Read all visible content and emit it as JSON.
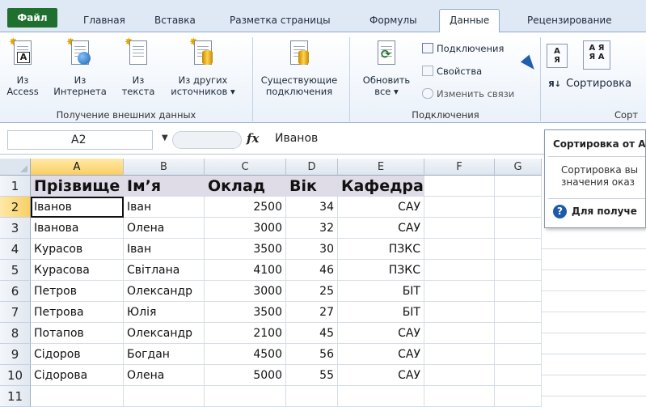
{
  "tabs": [
    "Файл",
    "Главная",
    "Вставка",
    "Разметка страницы",
    "Формулы",
    "Данные",
    "Рецензирование"
  ],
  "active_tab": "Данные",
  "ribbon": {
    "external_data": {
      "buttons": [
        {
          "line1": "Из",
          "line2": "Access",
          "icon": "access-icon"
        },
        {
          "line1": "Из",
          "line2": "Интернета",
          "icon": "web-icon"
        },
        {
          "line1": "Из",
          "line2": "текста",
          "icon": "text-file-icon"
        },
        {
          "line1": "Из других",
          "line2": "источников ▾",
          "icon": "other-sources-icon"
        },
        {
          "line1": "Существующие",
          "line2": "подключения",
          "icon": "existing-connections-icon"
        }
      ],
      "label": "Получение внешних данных"
    },
    "connections": {
      "refresh": {
        "line1": "Обновить",
        "line2": "все ▾"
      },
      "small": [
        "Подключения",
        "Свойства",
        "Изменить связи"
      ],
      "label": "Подключения"
    },
    "sort": {
      "sort_button": "Сортировка",
      "label": "Сорт"
    }
  },
  "formula_bar": {
    "name_box": "A2",
    "fx": "fx",
    "value": "Иванов"
  },
  "sheet": {
    "columns": [
      "A",
      "B",
      "C",
      "D",
      "E",
      "F",
      "G"
    ],
    "selected_column": "A",
    "row_numbers": [
      "1",
      "2",
      "3",
      "4",
      "5",
      "6",
      "7",
      "8",
      "9",
      "10",
      "11"
    ],
    "selected_row": "2",
    "header": [
      "Прізвище",
      "Ім’я",
      "Оклад",
      "Вік",
      "Кафедра"
    ],
    "rows": [
      [
        "Іванов",
        "Іван",
        "2500",
        "34",
        "САУ"
      ],
      [
        "Іванова",
        "Олена",
        "3000",
        "32",
        "САУ"
      ],
      [
        "Курасов",
        "Іван",
        "3500",
        "30",
        "ПЗКС"
      ],
      [
        "Курасова",
        "Світлана",
        "4100",
        "46",
        "ПЗКС"
      ],
      [
        "Петров",
        "Олександр",
        "3000",
        "25",
        "БІТ"
      ],
      [
        "Петрова",
        "Юлія",
        "3500",
        "27",
        "БІТ"
      ],
      [
        "Потапов",
        "Олександр",
        "2100",
        "45",
        "САУ"
      ],
      [
        "Сідоров",
        "Богдан",
        "4500",
        "56",
        "САУ"
      ],
      [
        "Сідорова",
        "Олена",
        "5000",
        "55",
        "САУ"
      ]
    ]
  },
  "tooltip": {
    "title": "Сортировка от А",
    "body_line1": "Сортировка вы",
    "body_line2": "значения оказ",
    "help": "Для получе"
  }
}
